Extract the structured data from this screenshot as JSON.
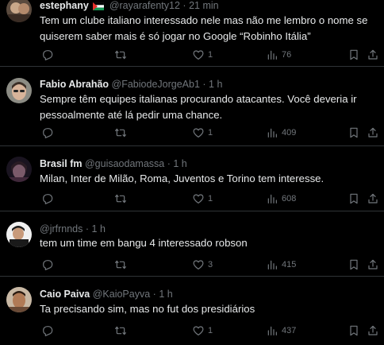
{
  "tweets": [
    {
      "name": "estephany",
      "flag": "palestine-flag-icon",
      "handle": "@rayarafenty12",
      "dot": "·",
      "time": "21 min",
      "text": "Tem um clube italiano interessado nele mas não me lembro o nome se quiserem saber mais é só jogar no Google “Robinho Itália”",
      "likes": "1",
      "views": "76"
    },
    {
      "name": "Fabio Abrahão",
      "handle": "@FabiodeJorgeAb1",
      "dot": "·",
      "time": "1 h",
      "text": "Sempre têm equipes italianas procurando atacantes. Você deveria ir pessoalmente até lá pedir uma chance.",
      "likes": "1",
      "views": "409"
    },
    {
      "name": "Brasil fm",
      "handle": "@guisaodamassa",
      "dot": "·",
      "time": "1 h",
      "text": "Milan, Inter de Milão, Roma, Juventos e Torino tem interesse.",
      "likes": "1",
      "views": "608"
    },
    {
      "name": "",
      "handle": "@jrfrnnds",
      "dot": "·",
      "time": "1 h",
      "text": "tem um time em bangu 4 interessado robson",
      "likes": "3",
      "views": "415"
    },
    {
      "name": "Caio Paiva",
      "handle": "@KaioPayva",
      "dot": "·",
      "time": "1 h",
      "text": "Ta precisando sim, mas no fut dos presidiários",
      "likes": "1",
      "views": "437"
    }
  ],
  "icons": {
    "reply": "reply-icon",
    "retweet": "retweet-icon",
    "like": "heart-icon",
    "views": "views-icon",
    "bookmark": "bookmark-icon",
    "share": "share-icon"
  },
  "colors": {
    "background": "#000000",
    "text": "#e7e9ea",
    "muted": "#71767b",
    "divider": "#2f3336"
  }
}
